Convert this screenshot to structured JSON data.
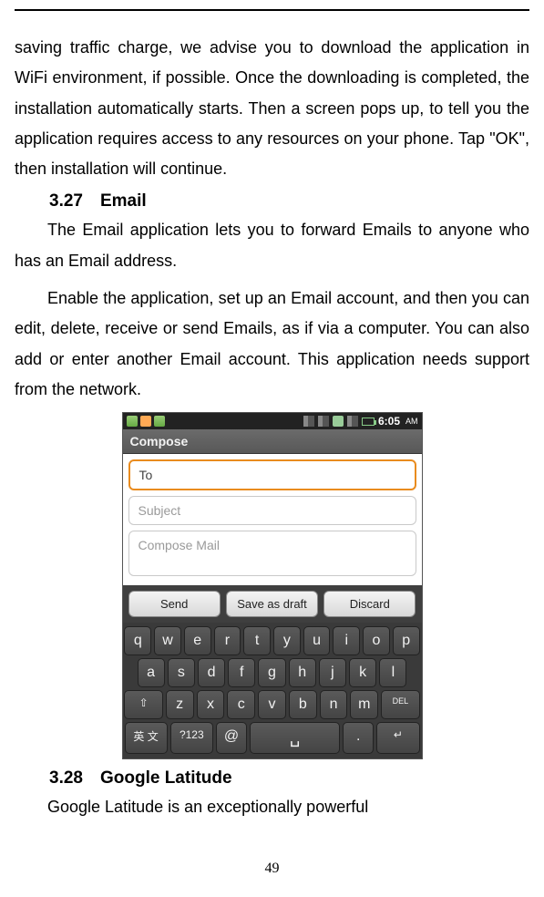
{
  "para1": "saving traffic charge, we advise you to download the application in WiFi environment, if possible. Once the downloading is completed, the installation automatically starts. Then a screen pops up, to tell you the application requires access to any resources on your phone. Tap \"OK\", then installation will continue.",
  "sec1": {
    "num": "3.27",
    "title": "Email"
  },
  "para2": "The Email application lets you to forward Emails to anyone who has an Email address.",
  "para3": "Enable the application, set up an Email account, and then you can edit, delete, receive or send Emails, as if via a computer. You can also add or enter another Email account. This application needs support from the network.",
  "screenshot": {
    "status_time": "6:05",
    "status_ampm": "AM",
    "header": "Compose",
    "to_placeholder": "To",
    "subject_placeholder": "Subject",
    "body_placeholder": "Compose Mail",
    "btn_send": "Send",
    "btn_save": "Save as draft",
    "btn_discard": "Discard",
    "row1": [
      "q",
      "w",
      "e",
      "r",
      "t",
      "y",
      "u",
      "i",
      "o",
      "p"
    ],
    "row2": [
      "a",
      "s",
      "d",
      "f",
      "g",
      "h",
      "j",
      "k",
      "l"
    ],
    "row3_shift": "⇧",
    "row3": [
      "z",
      "x",
      "c",
      "v",
      "b",
      "n",
      "m"
    ],
    "row3_del": "DEL",
    "row4_lang": "英 文",
    "row4_sym": "?123",
    "row4_at": "@",
    "row4_space": "␣",
    "row4_dot": ".",
    "row4_enter": "↵"
  },
  "sec2": {
    "num": "3.28",
    "title": "Google Latitude"
  },
  "para4": "Google Latitude is an exceptionally powerful",
  "pagenum": "49"
}
